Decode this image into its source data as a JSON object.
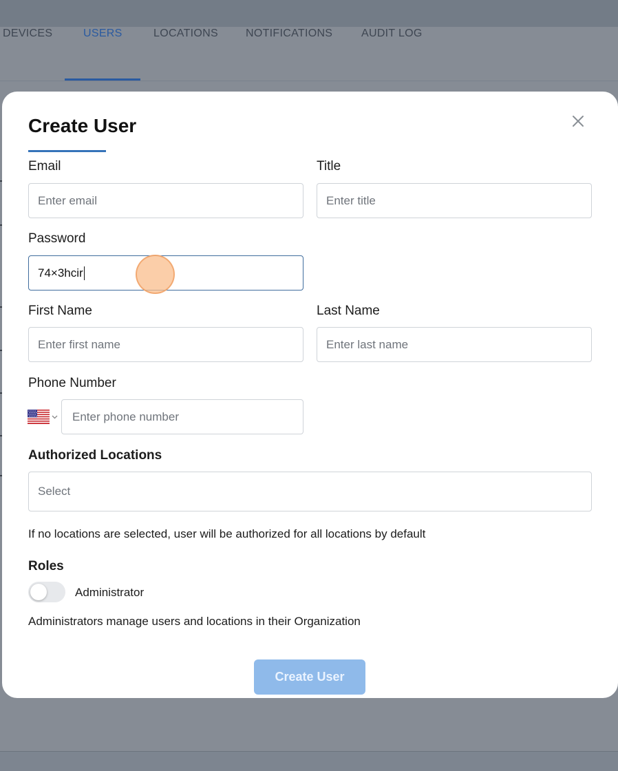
{
  "background": {
    "tabs": [
      {
        "label": "DEVICES",
        "active": false
      },
      {
        "label": "USERS",
        "active": true
      },
      {
        "label": "LOCATIONS",
        "active": false
      },
      {
        "label": "NOTIFICATIONS",
        "active": false
      },
      {
        "label": "AUDIT LOG",
        "active": false
      }
    ]
  },
  "modal": {
    "title": "Create User",
    "close_icon": "close-icon",
    "fields": {
      "email": {
        "label": "Email",
        "placeholder": "Enter email",
        "value": ""
      },
      "title": {
        "label": "Title",
        "placeholder": "Enter title",
        "value": ""
      },
      "password": {
        "label": "Password",
        "placeholder": "",
        "value": "74×3hcir"
      },
      "first_name": {
        "label": "First Name",
        "placeholder": "Enter first name",
        "value": ""
      },
      "last_name": {
        "label": "Last Name",
        "placeholder": "Enter last name",
        "value": ""
      },
      "phone": {
        "label": "Phone Number",
        "placeholder": "Enter phone number",
        "value": "",
        "country_icon": "us-flag-icon"
      }
    },
    "locations": {
      "label": "Authorized Locations",
      "placeholder": "Select",
      "helper": "If no locations are selected, user will be authorized for all locations by default"
    },
    "roles": {
      "label": "Roles",
      "toggle_label": "Administrator",
      "toggle_on": false,
      "helper": "Administrators manage users and locations in their Organization"
    },
    "submit_label": "Create User"
  },
  "colors": {
    "accent": "#3573b9",
    "submit_disabled": "#8fbaea",
    "overlay": "#868c95"
  }
}
